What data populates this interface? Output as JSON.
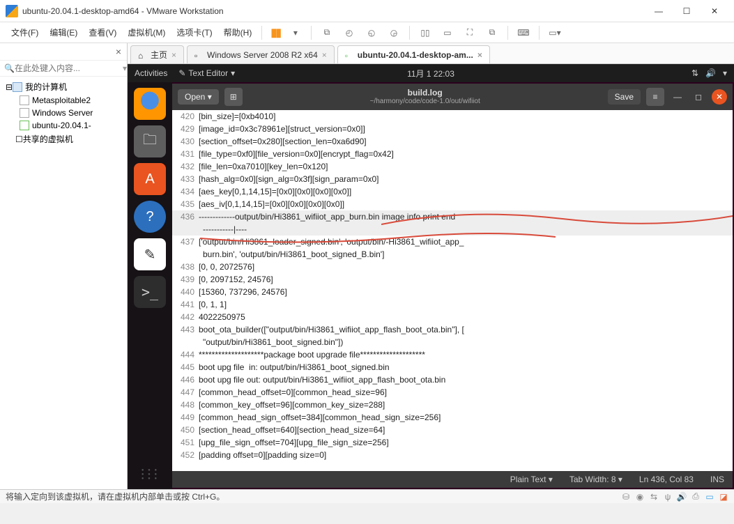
{
  "vmware": {
    "title": "ubuntu-20.04.1-desktop-amd64 - VMware Workstation",
    "menu": [
      "文件(F)",
      "编辑(E)",
      "查看(V)",
      "虚拟机(M)",
      "选项卡(T)",
      "帮助(H)"
    ],
    "status": "将输入定向到该虚拟机，请在虚拟机内部单击或按 Ctrl+G。"
  },
  "sidebar": {
    "search_ph": "在此处键入内容...",
    "root": "我的计算机",
    "items": [
      "Metasploitable2",
      "Windows Server",
      "ubuntu-20.04.1-"
    ],
    "shared": "共享的虚拟机"
  },
  "tabs": {
    "home": "主页",
    "win": "Windows Server 2008 R2 x64",
    "ub": "ubuntu-20.04.1-desktop-am..."
  },
  "ubuntu": {
    "activities": "Activities",
    "app": "Text Editor",
    "clock": "11月 1  22:03"
  },
  "gedit": {
    "open": "Open",
    "save": "Save",
    "filename": "build.log",
    "path": "~/harmony/code/code-1.0/out/wifiiot",
    "status": {
      "lang": "Plain Text",
      "tab": "Tab Width: 8",
      "pos": "Ln 436, Col 83",
      "ins": "INS"
    },
    "lines": [
      {
        "n": "420",
        "t": "[bin_size]=[0xb4010]"
      },
      {
        "n": "429",
        "t": "[image_id=0x3c78961e][struct_version=0x0]]"
      },
      {
        "n": "430",
        "t": "[section_offset=0x280][section_len=0xa6d90]"
      },
      {
        "n": "431",
        "t": "[file_type=0xf0][file_version=0x0][encrypt_flag=0x42]"
      },
      {
        "n": "432",
        "t": "[file_len=0xa7010][key_len=0x120]"
      },
      {
        "n": "433",
        "t": "[hash_alg=0x0][sign_alg=0x3f][sign_param=0x0]"
      },
      {
        "n": "434",
        "t": "[aes_key[0,1,14,15]=[0x0][0x0][0x0][0x0]]"
      },
      {
        "n": "435",
        "t": "[aes_iv[0,1,14,15]=[0x0][0x0][0x0][0x0]]"
      },
      {
        "n": "436",
        "t": "-------------output/bin/Hi3861_wifiiot_app_burn.bin image info print end-----------|----",
        "hl": true,
        "wrap": true
      },
      {
        "n": "437",
        "t": "['output/bin/Hi3861_loader_signed.bin', 'output/bin/-Hi3861_wifiiot_app_burn.bin', 'output/bin/Hi3861_boot_signed_B.bin']",
        "wrap": true
      },
      {
        "n": "438",
        "t": "[0, 0, 2072576]"
      },
      {
        "n": "439",
        "t": "[0, 2097152, 24576]"
      },
      {
        "n": "440",
        "t": "[15360, 737296, 24576]"
      },
      {
        "n": "441",
        "t": "[0, 1, 1]"
      },
      {
        "n": "442",
        "t": "4022250975"
      },
      {
        "n": "443",
        "t": "boot_ota_builder([\"output/bin/Hi3861_wifiiot_app_flash_boot_ota.bin\"], [\"output/bin/Hi3861_boot_signed.bin\"])",
        "wrap": true
      },
      {
        "n": "444",
        "t": "********************package boot upgrade file********************"
      },
      {
        "n": "445",
        "t": "boot upg file  in: output/bin/Hi3861_boot_signed.bin"
      },
      {
        "n": "446",
        "t": "boot upg file out: output/bin/Hi3861_wifiiot_app_flash_boot_ota.bin"
      },
      {
        "n": "447",
        "t": "[common_head_offset=0][common_head_size=96]"
      },
      {
        "n": "448",
        "t": "[common_key_offset=96][common_key_size=288]"
      },
      {
        "n": "449",
        "t": "[common_head_sign_offset=384][common_head_sign_size=256]"
      },
      {
        "n": "450",
        "t": "[section_head_offset=640][section_head_size=64]"
      },
      {
        "n": "451",
        "t": "[upg_file_sign_offset=704][upg_file_sign_size=256]"
      },
      {
        "n": "452",
        "t": "[padding offset=0][padding size=0]"
      }
    ]
  }
}
